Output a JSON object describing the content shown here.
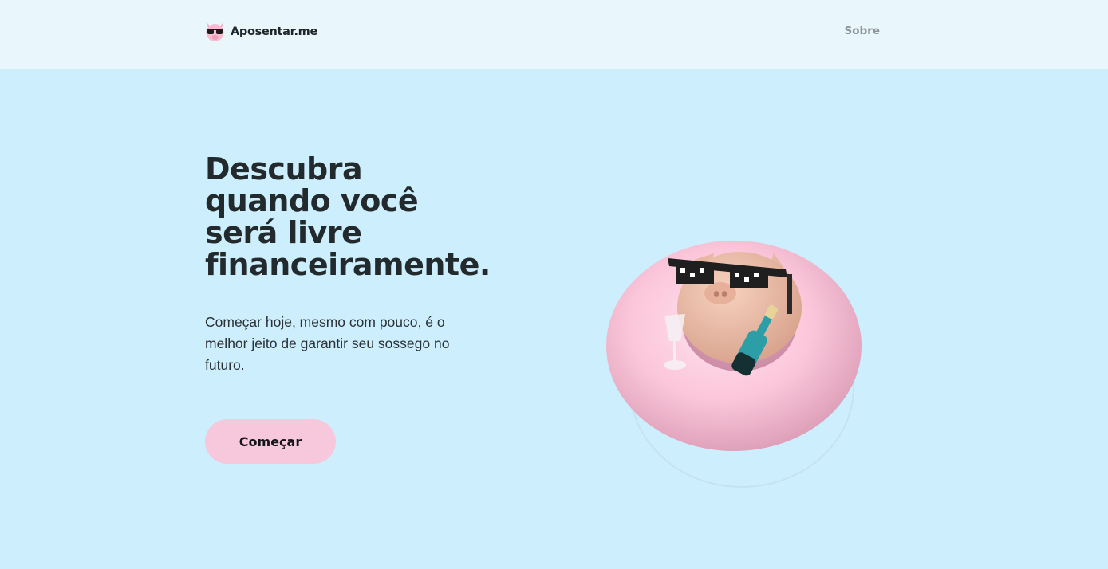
{
  "header": {
    "brand_name": "Aposentar.me",
    "brand_logo_icon": "pig-sunglasses-icon",
    "nav": {
      "sobre": "Sobre"
    }
  },
  "hero": {
    "title_lines": [
      "Descubra",
      "quando você",
      "será livre",
      "financeiramente."
    ],
    "description": "Começar hoje, mesmo com pouco, é o melhor jeito de garantir seu sossego no futuro.",
    "cta_label": "Começar",
    "illustration_icon": "pig-on-pool-float-illustration"
  },
  "colors": {
    "background": "#cdeefc",
    "header_background": "#e9f7fd",
    "button": "#f7c7dc",
    "text": "#232a2d",
    "nav_text": "#8d9599"
  }
}
